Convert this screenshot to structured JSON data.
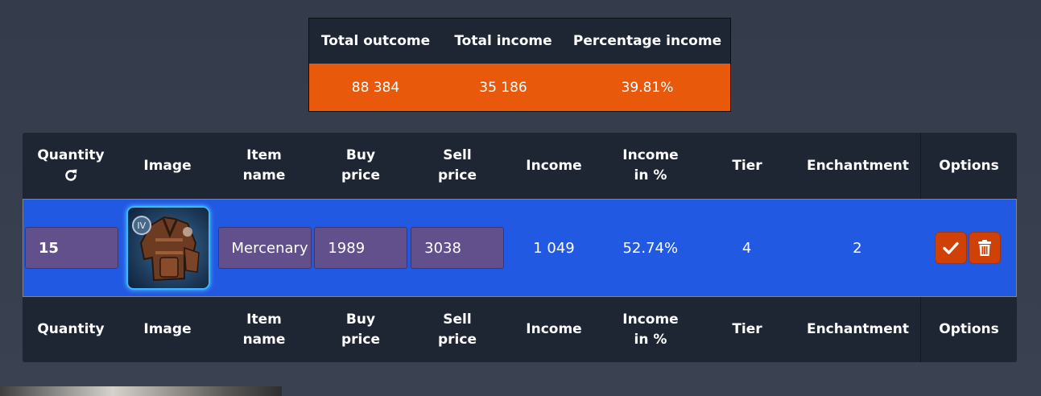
{
  "summary": {
    "headers": [
      "Total outcome",
      "Total income",
      "Percentage income"
    ],
    "values": [
      "88 384",
      "35 186",
      "39.81%"
    ]
  },
  "table": {
    "header_top": {
      "quantity": "Quantity",
      "image": "Image",
      "item_name_1": "Item",
      "item_name_2": "name",
      "buy_1": "Buy",
      "buy_2": "price",
      "sell_1": "Sell",
      "sell_2": "price",
      "income": "Income",
      "pct_1": "Income",
      "pct_2": "in %",
      "tier": "Tier",
      "enchantment": "Enchantment",
      "options": "Options"
    },
    "row": {
      "quantity": "15",
      "item_name": "Mercenary Jacket",
      "buy_price": "1989",
      "sell_price": "3038",
      "income": "1 049",
      "income_pct": "52.74%",
      "tier": "4",
      "enchantment": "2",
      "image_tier_badge": "IV"
    }
  },
  "icons": {
    "refresh": "refresh-icon",
    "confirm": "check-icon",
    "delete": "trash-icon"
  },
  "colors": {
    "accent_orange": "#e8590c",
    "row_blue": "#2259e3",
    "input_purple": "#62508c",
    "button_orange": "#cf4107",
    "panel": "#1e2533"
  }
}
